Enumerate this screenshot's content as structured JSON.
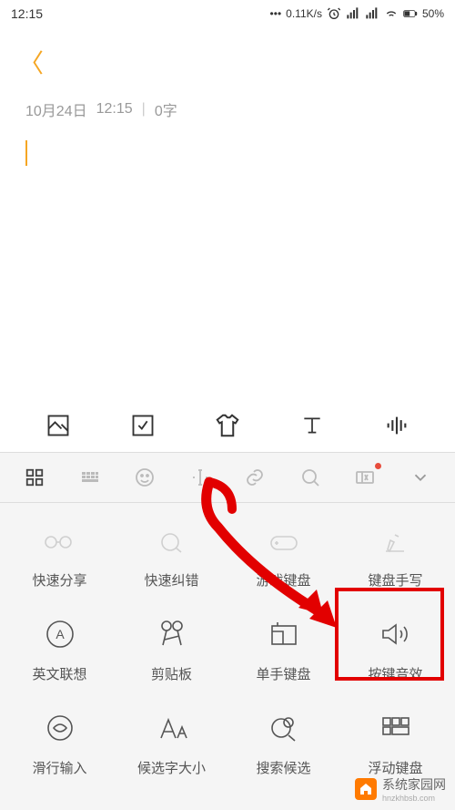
{
  "status": {
    "time": "12:15",
    "speed": "0.11K/s",
    "battery": "50%"
  },
  "meta": {
    "date": "10月24日",
    "time": "12:15",
    "words": "0字"
  },
  "toolbar_icons": [
    "image-icon",
    "checkbox-icon",
    "shirt-icon",
    "text-icon",
    "voice-icon"
  ],
  "ime_icons": [
    "grid-icon",
    "keyboard-icon",
    "emoji-icon",
    "cursor-icon",
    "link-icon",
    "search-icon",
    "coupon-icon",
    "chevron-icon"
  ],
  "panel": {
    "row1": [
      {
        "label": "快速分享",
        "icon": "share-icon"
      },
      {
        "label": "快速纠错",
        "icon": "correct-icon"
      },
      {
        "label": "游戏键盘",
        "icon": "game-icon"
      },
      {
        "label": "键盘手写",
        "icon": "handwrite-icon"
      }
    ],
    "row2": [
      {
        "label": "英文联想",
        "icon": "english-icon"
      },
      {
        "label": "剪贴板",
        "icon": "clipboard-icon"
      },
      {
        "label": "单手键盘",
        "icon": "onehand-icon"
      },
      {
        "label": "按键音效",
        "icon": "sound-icon"
      }
    ],
    "row3": [
      {
        "label": "滑行输入",
        "icon": "swipe-icon"
      },
      {
        "label": "候选字大小",
        "icon": "fontsize-icon"
      },
      {
        "label": "搜索候选",
        "icon": "searchcand-icon"
      },
      {
        "label": "浮动键盘",
        "icon": "float-icon"
      }
    ]
  },
  "watermark": {
    "title": "系统家园网",
    "sub": "hnzkhbsb.com"
  }
}
